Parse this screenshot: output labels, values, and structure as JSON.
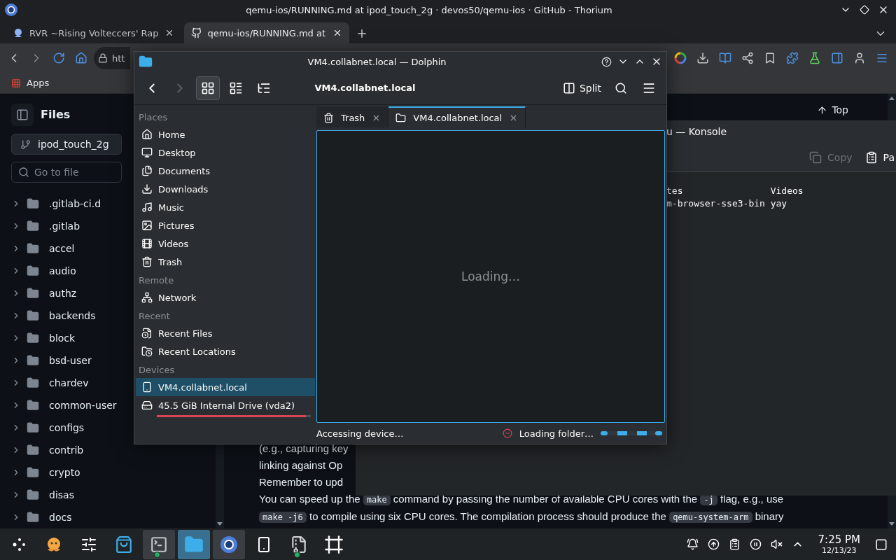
{
  "browser": {
    "title": "qemu-ios/RUNNING.md at ipod_touch_2g · devos50/qemu-ios · GitHub - Thorium",
    "tabs": [
      {
        "label": "RVR ~Rising Volteccers' Rap",
        "kind": "site",
        "selected": false
      },
      {
        "label": "qemu-ios/RUNNING.md at",
        "kind": "github",
        "selected": true
      }
    ],
    "address": "htt",
    "bookmarks": [
      {
        "label": "Apps"
      }
    ]
  },
  "files_panel": {
    "title": "Files",
    "branch": "ipod_touch_2g",
    "search_placeholder": "Go to file",
    "folders": [
      ".gitlab-ci.d",
      ".gitlab",
      "accel",
      "audio",
      "authz",
      "backends",
      "block",
      "bsd-user",
      "chardev",
      "common-user",
      "configs",
      "contrib",
      "crypto",
      "disas",
      "docs"
    ]
  },
  "top_button": "Top",
  "readme_lines": [
    [
      {
        "kind": "text",
        "text": "(e.g., capturing key"
      }
    ],
    [
      {
        "kind": "text",
        "text": "linking against Op"
      }
    ],
    [
      {
        "kind": "text",
        "text": "Remember to upd"
      }
    ],
    [
      {
        "kind": "text",
        "text": "You can speed up the "
      },
      {
        "kind": "code",
        "text": "make"
      },
      {
        "kind": "text",
        "text": " command by passing the number of available CPU cores with the "
      },
      {
        "kind": "code",
        "text": "-j"
      },
      {
        "kind": "text",
        "text": " flag, e.g., use"
      }
    ],
    [
      {
        "kind": "code",
        "text": "make -j6"
      },
      {
        "kind": "text",
        "text": " to compile using six CPU cores. The compilation process should produce the "
      },
      {
        "kind": "code",
        "text": "qemu-system-arm"
      },
      {
        "kind": "text",
        "text": " binary"
      }
    ]
  ],
  "konsole": {
    "title": "u — Konsole",
    "toolbar": [
      {
        "label": "Copy",
        "kind": "copy",
        "disabled": true
      },
      {
        "label": "Pa",
        "kind": "paste",
        "disabled": false
      }
    ],
    "terminal_lines": [
      "tes                Videos",
      "m-browser-sse3-bin yay"
    ]
  },
  "dolphin": {
    "title": "VM4.collabnet.local — Dolphin",
    "location": "VM4.collabnet.local",
    "view_modes": [
      {
        "kind": "icons",
        "selected": true
      },
      {
        "kind": "compact",
        "selected": false
      },
      {
        "kind": "details",
        "selected": false
      }
    ],
    "split_label": "Split",
    "tabs": [
      {
        "label": "Trash",
        "kind": "trash",
        "selected": false
      },
      {
        "label": "VM4.collabnet.local",
        "kind": "folder",
        "selected": true
      }
    ],
    "sections": [
      {
        "heading": "Places",
        "items": [
          {
            "label": "Home",
            "kind": "home",
            "selected": false
          },
          {
            "label": "Desktop",
            "kind": "desktop",
            "selected": false
          },
          {
            "label": "Documents",
            "kind": "documents",
            "selected": false
          },
          {
            "label": "Downloads",
            "kind": "downloads",
            "selected": false
          },
          {
            "label": "Music",
            "kind": "music",
            "selected": false
          },
          {
            "label": "Pictures",
            "kind": "pictures",
            "selected": false
          },
          {
            "label": "Videos",
            "kind": "videos",
            "selected": false
          },
          {
            "label": "Trash",
            "kind": "trash",
            "selected": false
          }
        ]
      },
      {
        "heading": "Remote",
        "items": [
          {
            "label": "Network",
            "kind": "network",
            "selected": false
          }
        ]
      },
      {
        "heading": "Recent",
        "items": [
          {
            "label": "Recent Files",
            "kind": "recent-files",
            "selected": false
          },
          {
            "label": "Recent Locations",
            "kind": "recent-locations",
            "selected": false
          }
        ]
      },
      {
        "heading": "Devices",
        "items": [
          {
            "label": "VM4.collabnet.local",
            "kind": "device",
            "selected": true
          },
          {
            "label": "45.5 GiB Internal Drive (vda2)",
            "kind": "drive",
            "selected": false,
            "level": 0.97
          }
        ]
      }
    ],
    "loading_text": "Loading…",
    "status_text": "Accessing device…",
    "progress_text": "Loading folder…"
  },
  "taskbar": {
    "apps": [
      {
        "kind": "launcher",
        "selected": false,
        "running": false,
        "badge": false
      },
      {
        "kind": "mascot",
        "selected": false,
        "running": false,
        "badge": false
      },
      {
        "kind": "settings",
        "selected": false,
        "running": false,
        "badge": false
      },
      {
        "kind": "store",
        "selected": false,
        "running": false,
        "badge": false
      },
      {
        "kind": "terminal",
        "selected": false,
        "running": true,
        "badge": true
      },
      {
        "kind": "files",
        "selected": true,
        "running": true,
        "badge": false
      },
      {
        "kind": "browser",
        "selected": false,
        "running": true,
        "badge": false
      },
      {
        "kind": "phone",
        "selected": false,
        "running": false,
        "badge": false
      },
      {
        "kind": "archive",
        "selected": false,
        "running": false,
        "badge": true
      },
      {
        "kind": "frame",
        "selected": false,
        "running": false,
        "badge": false
      }
    ],
    "clock_time": "7:25 PM",
    "clock_date": "12/13/23"
  }
}
